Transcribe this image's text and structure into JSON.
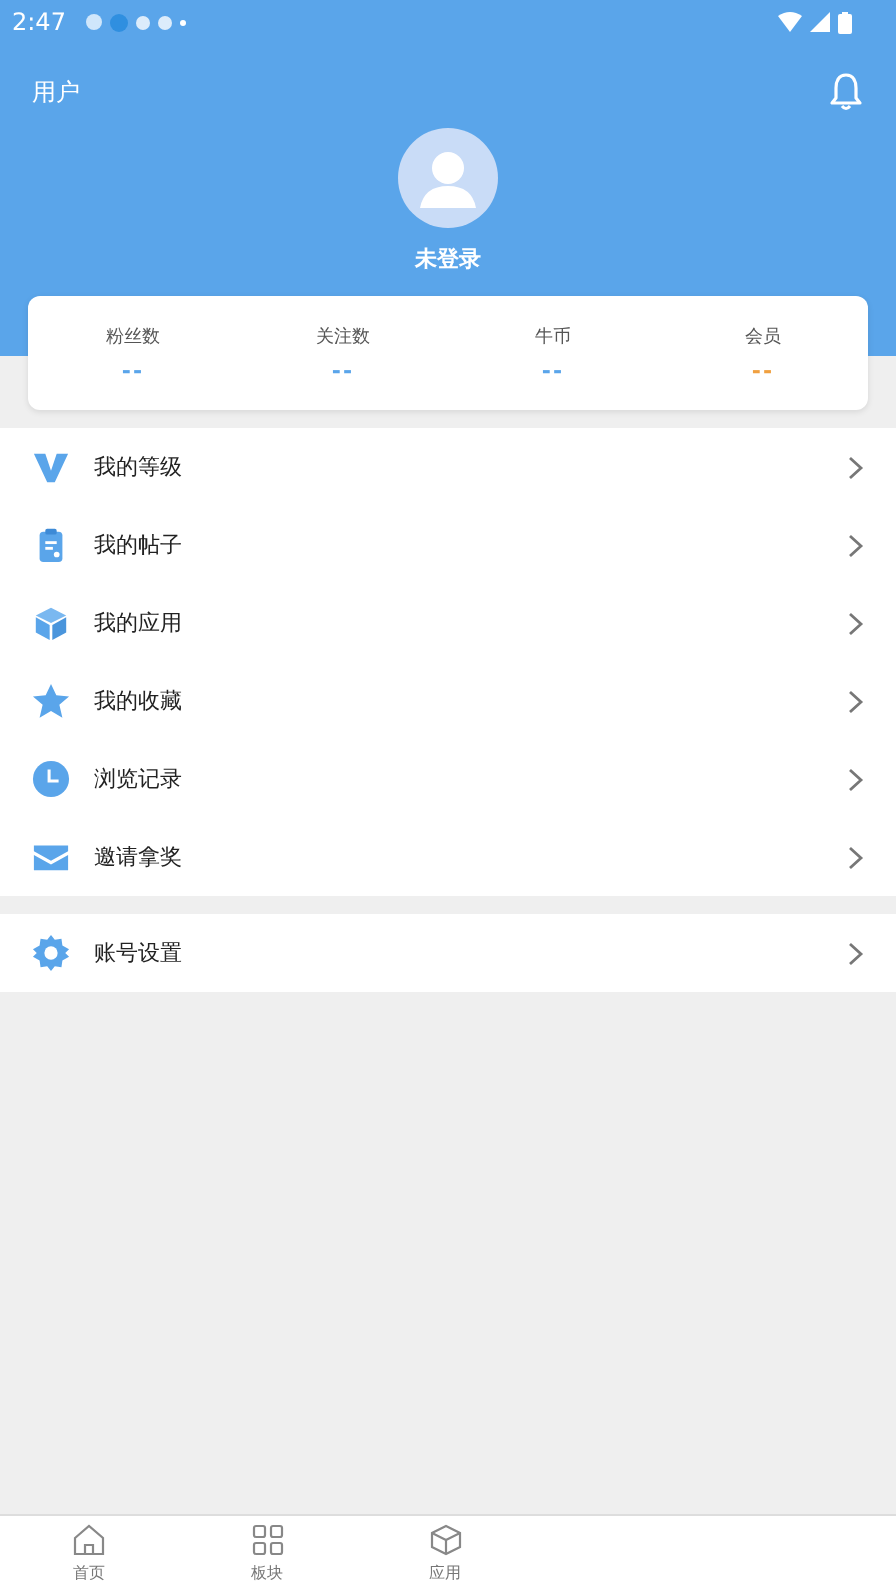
{
  "status_bar": {
    "time": "2:47"
  },
  "header": {
    "title": "用户",
    "username": "未登录"
  },
  "stats": [
    {
      "label": "粉丝数",
      "value": "--",
      "color": "#5aa5ea"
    },
    {
      "label": "关注数",
      "value": "--",
      "color": "#5aa5ea"
    },
    {
      "label": "牛币",
      "value": "--",
      "color": "#5aa5ea"
    },
    {
      "label": "会员",
      "value": "--",
      "color": "#f0a040"
    }
  ],
  "menu_groups": [
    [
      {
        "label": "我的等级",
        "kind": "level"
      },
      {
        "label": "我的帖子",
        "kind": "posts"
      },
      {
        "label": "我的应用",
        "kind": "apps"
      },
      {
        "label": "我的收藏",
        "kind": "favorites"
      },
      {
        "label": "浏览记录",
        "kind": "history"
      },
      {
        "label": "邀请拿奖",
        "kind": "invite"
      }
    ],
    [
      {
        "label": "账号设置",
        "kind": "settings"
      }
    ]
  ],
  "bottom_nav": [
    {
      "label": "首页",
      "kind": "home"
    },
    {
      "label": "板块",
      "kind": "grid"
    },
    {
      "label": "应用",
      "kind": "box"
    }
  ]
}
